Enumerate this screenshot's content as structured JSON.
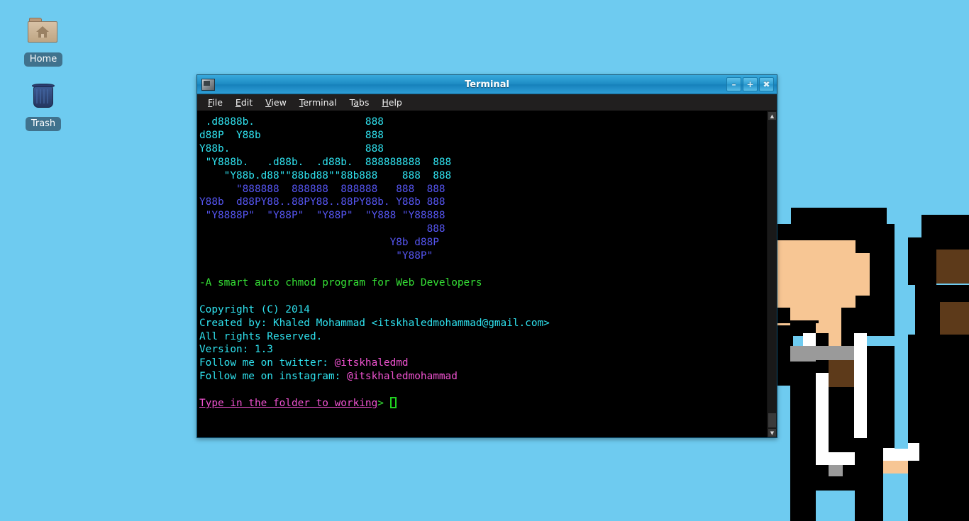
{
  "desktop": {
    "background_color": "#6ecbf0",
    "icons": [
      {
        "name": "home",
        "label": "Home",
        "icon": "folder-home-icon"
      },
      {
        "name": "trash",
        "label": "Trash",
        "icon": "trash-bin-icon"
      }
    ],
    "wallpaper": "pixel-art-characters-in-suits"
  },
  "window": {
    "title": "Terminal",
    "icon": "terminal-app-icon",
    "buttons": {
      "minimize": "–",
      "maximize": "+",
      "close": "✖"
    },
    "menu": [
      {
        "label": "File",
        "mnemonic": "F",
        "rest": "ile"
      },
      {
        "label": "Edit",
        "mnemonic": "E",
        "rest": "dit"
      },
      {
        "label": "View",
        "mnemonic": "V",
        "rest": "iew"
      },
      {
        "label": "Terminal",
        "mnemonic": "T",
        "rest": "erminal"
      },
      {
        "label": "Tabs",
        "mnemonic": "T",
        "rest": "abs"
      },
      {
        "label": "Help",
        "mnemonic": "H",
        "rest": "elp"
      }
    ],
    "scrollbar": {
      "up_arrow": "▲",
      "down_arrow": "▼"
    }
  },
  "terminal": {
    "background_color": "#000000",
    "ascii_art_cyan": [
      " .d8888b.                  888",
      "d88P  Y88b                 888",
      "Y88b.                      888",
      " \"Y888b.   .d88b.  .d88b.  888888888  888",
      "    \"Y88b.d88\"\"88bd88\"\"88b888    888  888"
    ],
    "ascii_art_blue": [
      "      \"888888  888888  888888   888  888",
      "Y88b  d88PY88..88PY88..88PY88b. Y88b 888",
      " \"Y8888P\"  \"Y88P\"  \"Y88P\"  \"Y888 \"Y88888",
      "                                     888",
      "                               Y8b d88P",
      "                                \"Y88P\""
    ],
    "tagline": "-A smart auto chmod program for Web Developers",
    "info_lines": [
      "Copyright (C) 2014",
      "Created by: Khaled Mohammad <itskhaledmohammad@gmail.com>",
      "All rights Reserved.",
      "Version: 1.3"
    ],
    "social": [
      {
        "label": "Follow me on twitter: ",
        "handle": "@itskhaledmd"
      },
      {
        "label": "Follow me on instagram: ",
        "handle": "@itskhaledmohammad"
      }
    ],
    "prompt": {
      "text": "Type in the folder to working",
      "symbol": "> ",
      "input_value": ""
    },
    "colors": {
      "cyan": "#2fe2ef",
      "blue": "#5555f0",
      "green": "#35e035",
      "magenta": "#ef52d0",
      "cursor": "#20d020"
    }
  }
}
